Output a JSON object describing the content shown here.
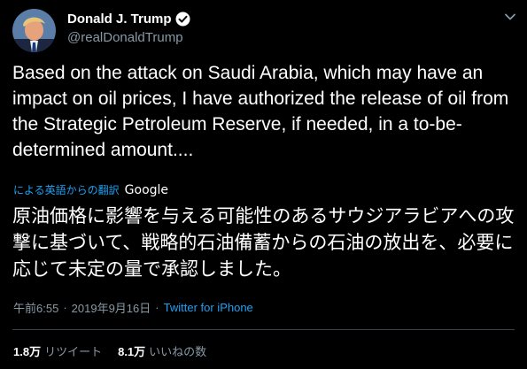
{
  "colors": {
    "background": "#000000",
    "text": "#ffffff",
    "secondary": "#8899a6",
    "link": "#1da1f2"
  },
  "author": {
    "display_name": "Donald J. Trump",
    "handle": "@realDonaldTrump",
    "verified": true,
    "avatar_icon": "avatar-image",
    "verified_icon": "verified-badge-icon",
    "menu_icon": "chevron-down-icon"
  },
  "tweet": {
    "text": "Based on the attack on Saudi Arabia, which may have an impact on oil prices, I have authorized the release of oil from the Strategic Petroleum Reserve, if needed, in a to-be-determined amount....",
    "translation_label": "による英語からの翻訳",
    "translation_provider": "Google",
    "translated_text": "原油価格に影響を与える可能性のあるサウジアラビアへの攻撃に基づいて、戦略的石油備蓄からの石油の放出を、必要に応じて未定の量で承認しました。"
  },
  "meta": {
    "time": "午前6:55",
    "separator": "·",
    "date": "2019年9月16日",
    "source": "Twitter for iPhone"
  },
  "stats": {
    "retweets_count": "1.8万",
    "retweets_label": "リツイート",
    "likes_count": "8.1万",
    "likes_label": "いいねの数"
  }
}
